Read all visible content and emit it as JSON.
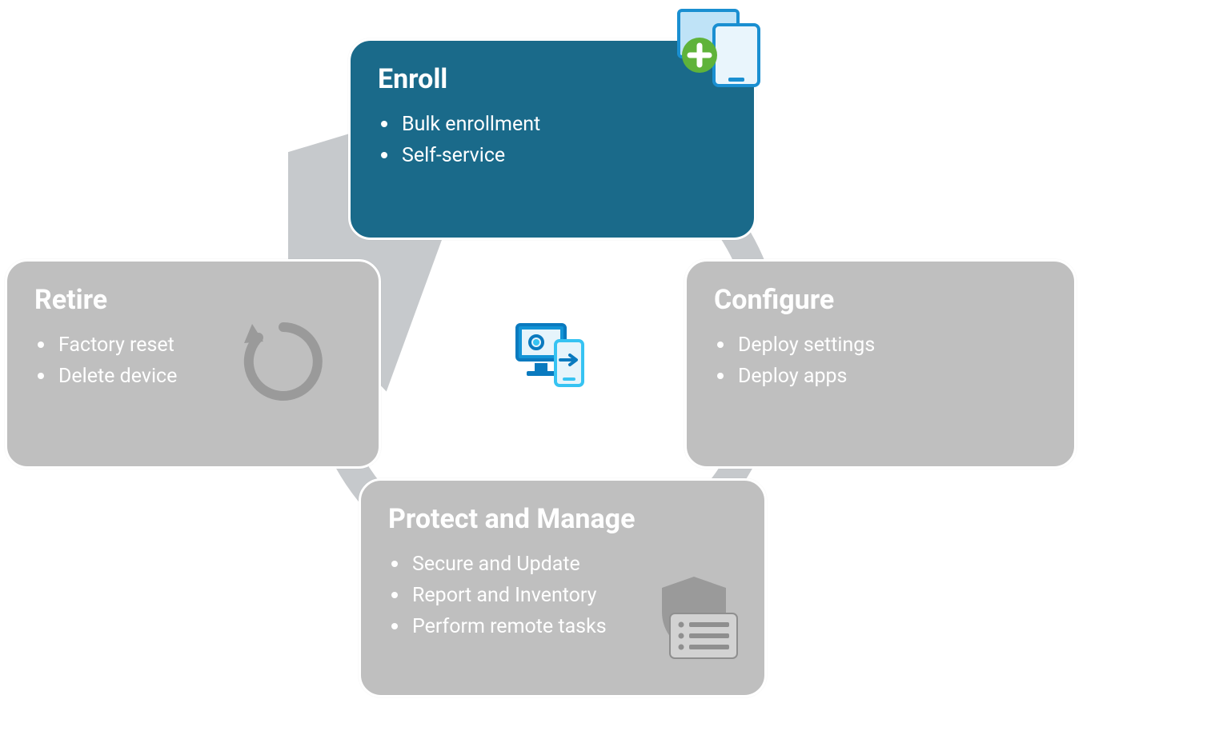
{
  "cycle": {
    "stages": [
      {
        "key": "enroll",
        "title": "Enroll",
        "items": [
          "Bulk enrollment",
          "Self-service"
        ],
        "active": true
      },
      {
        "key": "configure",
        "title": "Configure",
        "items": [
          "Deploy settings",
          "Deploy apps"
        ],
        "active": false
      },
      {
        "key": "protect",
        "title": "Protect and Manage",
        "items": [
          "Secure and Update",
          "Report and Inventory",
          "Perform remote tasks"
        ],
        "active": false
      },
      {
        "key": "retire",
        "title": "Retire",
        "items": [
          "Factory reset",
          "Delete device"
        ],
        "active": false
      }
    ]
  },
  "colors": {
    "inactive_bg": "#bfbfbf",
    "active_bg": "#1a6a8a",
    "ring": "#c6c9cc",
    "accent_blue": "#0a7abf",
    "accent_green": "#5fb33a"
  },
  "icons": {
    "enroll": "devices-add-icon",
    "configure": "apps-grid-icon",
    "protect": "shield-list-icon",
    "retire": "refresh-cycle-icon",
    "center": "device-sync-icon"
  }
}
